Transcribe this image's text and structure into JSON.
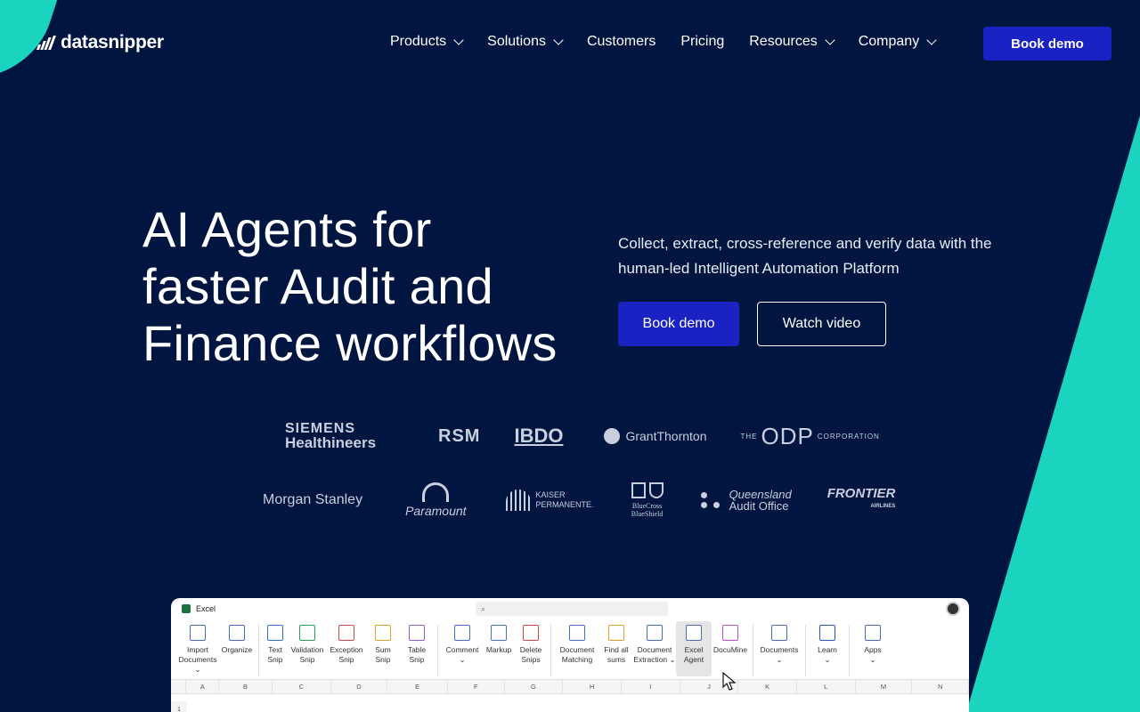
{
  "brand": {
    "name": "datasnipper"
  },
  "nav": {
    "items": [
      {
        "label": "Products",
        "dropdown": true
      },
      {
        "label": "Solutions",
        "dropdown": true
      },
      {
        "label": "Customers",
        "dropdown": false
      },
      {
        "label": "Pricing",
        "dropdown": false
      },
      {
        "label": "Resources",
        "dropdown": true
      },
      {
        "label": "Company",
        "dropdown": true
      }
    ],
    "cta": "Book demo"
  },
  "hero": {
    "title_line1": "AI Agents for",
    "title_line2": "faster Audit and",
    "title_line3": "Finance workflows",
    "subtitle": "Collect, extract, cross-reference and verify data with the human-led Intelligent Automation Platform",
    "primary_cta": "Book demo",
    "secondary_cta": "Watch video"
  },
  "customers": {
    "row1": {
      "siemens_a": "SIEMENS",
      "siemens_b": "Healthineers",
      "rsm": "RSM",
      "bdo": "IBDO",
      "grant": "GrantThornton",
      "odp_the": "THE",
      "odp": "ODP",
      "odp_corp": "CORPORATION"
    },
    "row2": {
      "ms": "Morgan Stanley",
      "para": "Paramount",
      "kaiser_a": "KAISER",
      "kaiser_b": "PERMANENTE.",
      "bc_a": "BlueCross",
      "bc_b": "BlueShield",
      "qao_a": "Queensland",
      "qao_b": "Audit Office",
      "frontier": "FRONTIER",
      "frontier_sub": "AIRLINES"
    }
  },
  "excel": {
    "app_title": "Excel",
    "ribbon": [
      {
        "l1": "Import",
        "l2": "Documents ⌄",
        "icon": "import-icon"
      },
      {
        "l1": "Organize",
        "l2": "",
        "icon": "folder-icon"
      },
      {
        "l1": "Text",
        "l2": "Snip",
        "icon": "text-snip-icon"
      },
      {
        "l1": "Validation",
        "l2": "Snip",
        "icon": "validation-snip-icon"
      },
      {
        "l1": "Exception",
        "l2": "Snip",
        "icon": "exception-snip-icon"
      },
      {
        "l1": "Sum",
        "l2": "Snip",
        "icon": "sum-snip-icon"
      },
      {
        "l1": "Table",
        "l2": "Snip",
        "icon": "table-snip-icon"
      },
      {
        "l1": "Comment",
        "l2": "⌄",
        "icon": "comment-icon"
      },
      {
        "l1": "Markup",
        "l2": "",
        "icon": "markup-icon"
      },
      {
        "l1": "Delete",
        "l2": "Snips",
        "icon": "delete-snips-icon"
      },
      {
        "l1": "Document",
        "l2": "Matching",
        "icon": "document-matching-icon"
      },
      {
        "l1": "Find all",
        "l2": "sums",
        "icon": "find-sums-icon"
      },
      {
        "l1": "Document",
        "l2": "Extraction ⌄",
        "icon": "document-extraction-icon"
      },
      {
        "l1": "Excel",
        "l2": "Agent",
        "icon": "excel-agent-icon"
      },
      {
        "l1": "DocuMine",
        "l2": "",
        "icon": "documine-icon"
      },
      {
        "l1": "Documents",
        "l2": "⌄",
        "icon": "documents-icon"
      },
      {
        "l1": "Learn",
        "l2": "⌄",
        "icon": "learn-icon"
      },
      {
        "l1": "Apps",
        "l2": "⌄",
        "icon": "apps-icon"
      }
    ],
    "columns": [
      "A",
      "B",
      "C",
      "D",
      "E",
      "F",
      "G",
      "H",
      "I",
      "J",
      "K",
      "L",
      "M",
      "N"
    ],
    "row1": "1"
  },
  "colors": {
    "background": "#001540",
    "accent": "#1ad4c0",
    "button": "#1a22c4"
  }
}
